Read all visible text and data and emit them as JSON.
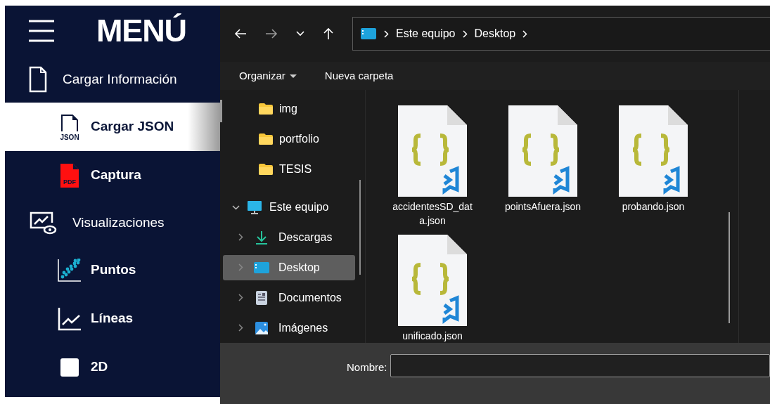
{
  "sidebar": {
    "title": "MENÚ",
    "sections": [
      {
        "label": "Cargar Información",
        "children": [
          {
            "label": "Cargar JSON",
            "icon_text": "JSON",
            "selected": true
          },
          {
            "label": "Captura",
            "icon_text": "PDF",
            "selected": false
          }
        ]
      },
      {
        "label": "Visualizaciones",
        "children": [
          {
            "label": "Puntos",
            "selected": false
          },
          {
            "label": "Líneas",
            "selected": false
          },
          {
            "label": "2D",
            "selected": false
          }
        ]
      }
    ]
  },
  "dialog": {
    "breadcrumb": [
      "Este equipo",
      "Desktop"
    ],
    "toolbar": {
      "organize": "Organizar",
      "new_folder": "Nueva carpeta"
    },
    "nav_pane": [
      {
        "label": "img",
        "selected": false
      },
      {
        "label": "portfolio",
        "selected": false
      },
      {
        "label": "TESIS",
        "selected": false
      },
      {
        "label": "Este equipo",
        "expanded": true,
        "selected": false,
        "children": [
          {
            "label": "Descargas",
            "expanded": false,
            "selected": false
          },
          {
            "label": "Desktop",
            "expanded": false,
            "selected": true
          },
          {
            "label": "Documentos",
            "expanded": false,
            "selected": false
          },
          {
            "label": "Imágenes",
            "expanded": false,
            "selected": false
          }
        ]
      }
    ],
    "files": [
      {
        "name": "accidentesSD_data.json"
      },
      {
        "name": "pointsAfuera.json"
      },
      {
        "name": "probando.json"
      },
      {
        "name": "unificado.json"
      }
    ],
    "filename": {
      "label": "Nombre:"
    }
  }
}
